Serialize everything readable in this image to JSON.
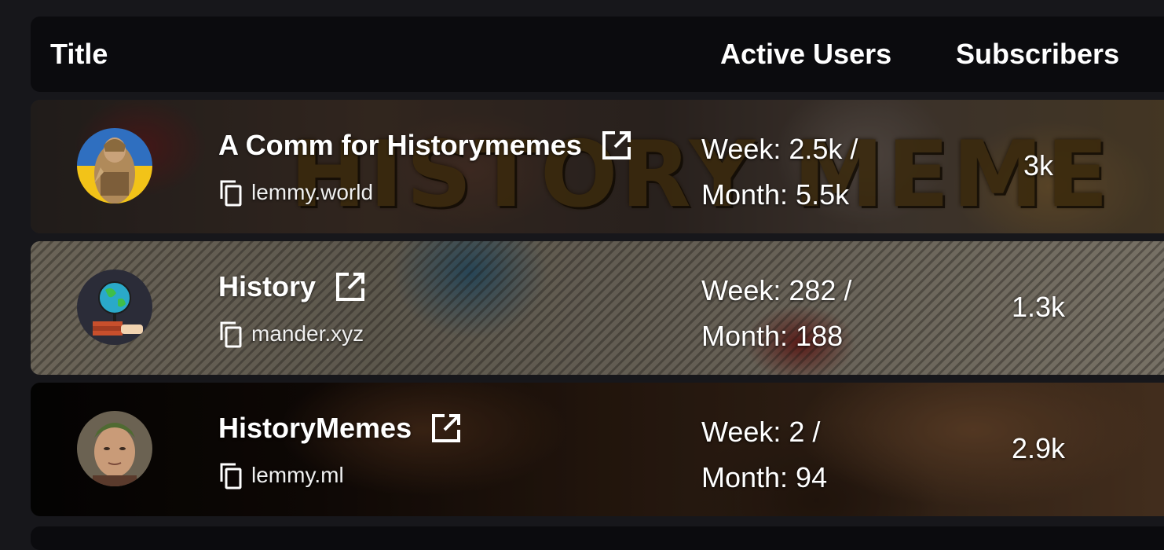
{
  "header": {
    "title": "Title",
    "active_users": "Active Users",
    "subscribers": "Subscribers"
  },
  "rows": [
    {
      "name": "A Comm for Historymemes",
      "instance": "lemmy.world",
      "week": "Week: 2.5k /",
      "month": "Month: 5.5k",
      "subscribers": "3k",
      "banner_text": "HISTORY MEME"
    },
    {
      "name": "History",
      "instance": "mander.xyz",
      "week": "Week: 282 /",
      "month": "Month: 188",
      "subscribers": "1.3k"
    },
    {
      "name": "HistoryMemes",
      "instance": "lemmy.ml",
      "week": "Week: 2 /",
      "month": "Month: 94",
      "subscribers": "2.9k"
    }
  ],
  "icons": {
    "external_link": "external-link-icon",
    "copy": "copy-icon"
  },
  "colors": {
    "page_bg": "#17171b",
    "header_bg": "#0b0b0e",
    "text": "#ffffff"
  }
}
